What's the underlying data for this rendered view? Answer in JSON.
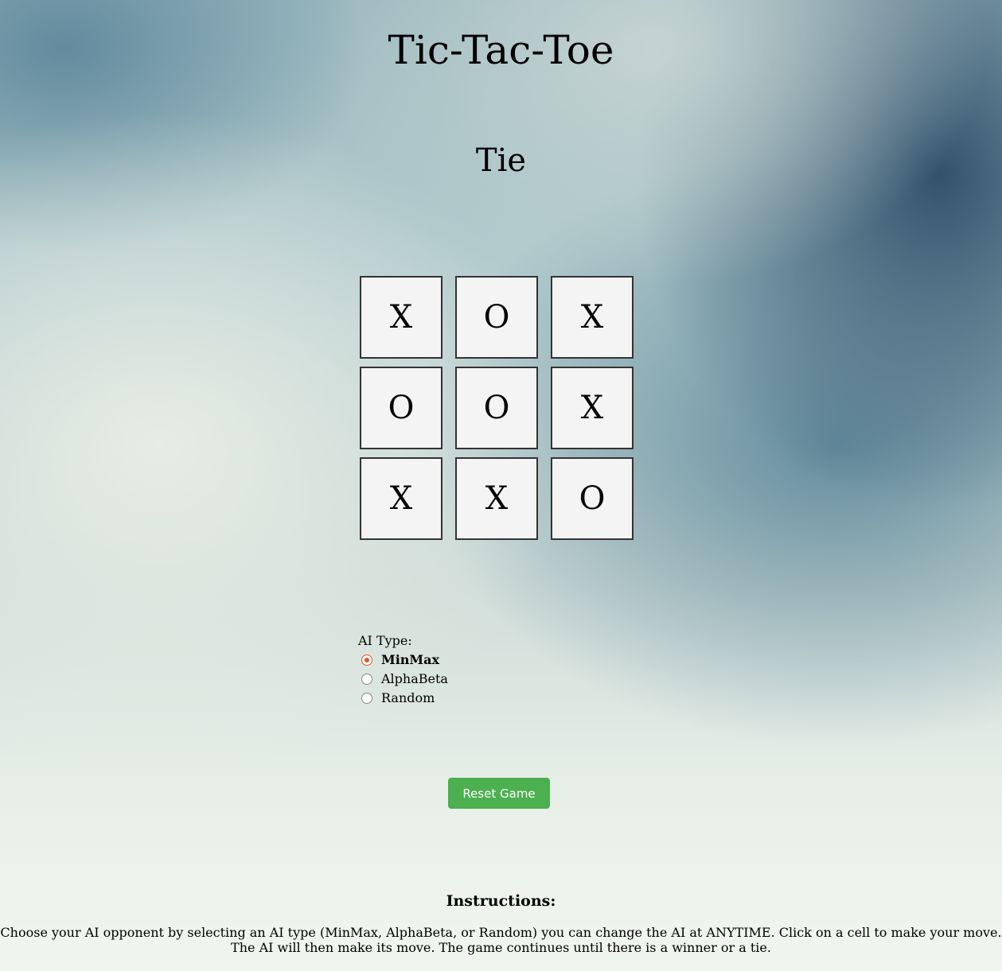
{
  "app": {
    "title": "Tic-Tac-Toe"
  },
  "status": "Tie",
  "board": {
    "cells": [
      "X",
      "O",
      "X",
      "O",
      "O",
      "X",
      "X",
      "X",
      "O"
    ]
  },
  "ai_type": {
    "label": "AI Type:",
    "selected": "MinMax",
    "options": [
      {
        "label": "MinMax",
        "checked": true
      },
      {
        "label": "AlphaBeta",
        "checked": false
      },
      {
        "label": "Random",
        "checked": false
      }
    ],
    "accent_color": "#e0562b"
  },
  "reset_button": {
    "label": "Reset Game",
    "color": "#4caf50"
  },
  "instructions": {
    "title": "Instructions:",
    "line1": "Choose your AI opponent by selecting an AI type (MinMax, AlphaBeta, or Random) you can change the AI at ANYTIME. Click on a cell to make your move.",
    "line2": "The AI will then make its move. The game continues until there is a winner or a tie."
  }
}
